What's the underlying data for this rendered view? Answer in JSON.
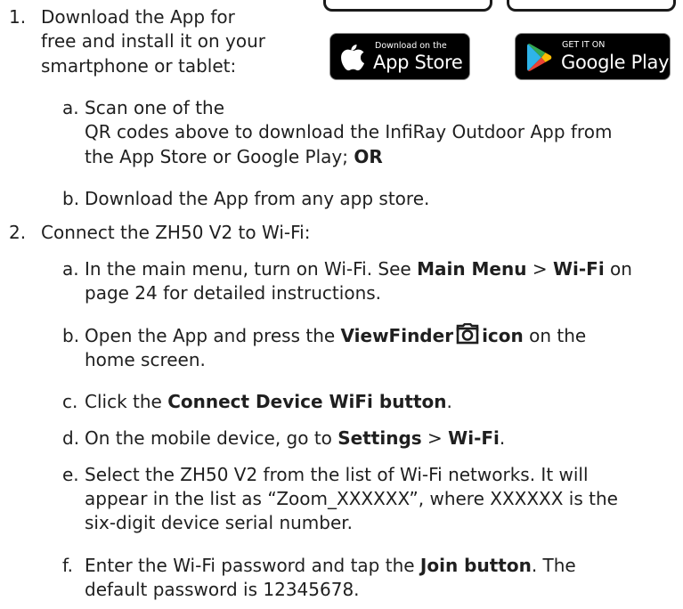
{
  "badges": {
    "app_store": {
      "small": "Download on the",
      "big": "App Store"
    },
    "google_play": {
      "small": "GET IT ON",
      "big": "Google Play"
    }
  },
  "step1": {
    "number": "1.",
    "lines": [
      "Download the App for",
      "free and install it on your",
      "smartphone or tablet:"
    ],
    "a": {
      "letter": "a.",
      "line1": "Scan one of the",
      "line2": "QR codes above to download the InfiRay Outdoor App from",
      "line3_pre": "the App Store or Google Play; ",
      "line3_bold": "OR"
    },
    "b": {
      "letter": "b.",
      "text": "Download the App from any app store."
    }
  },
  "step2": {
    "number": "2.",
    "text": "Connect the ZH50 V2 to Wi-Fi:",
    "a": {
      "letter": "a.",
      "pre": "In the main menu, turn on Wi-Fi. See ",
      "bold1": "Main Menu",
      "sep": " > ",
      "bold2": "Wi-Fi",
      "post": " on",
      "line2": "page 24 for detailed instructions."
    },
    "b": {
      "letter": "b.",
      "pre": "Open the App and press the ",
      "bold1": "ViewFinder",
      "bold2": "icon",
      "post": " on the",
      "line2": "home screen."
    },
    "c": {
      "letter": "c.",
      "pre": "Click the ",
      "bold": "Connect Device WiFi button",
      "post": "."
    },
    "d": {
      "letter": "d.",
      "pre": "On the mobile device, go to ",
      "bold1": "Settings",
      "sep": " > ",
      "bold2": "Wi-Fi",
      "post": "."
    },
    "e": {
      "letter": "e.",
      "line1": "Select the ZH50 V2 from the list of Wi-Fi networks. It will",
      "line2": "appear in the list as “Zoom_XXXXXX”, where XXXXXX is the",
      "line3": "six-digit device serial number."
    },
    "f": {
      "letter": "f.",
      "pre": "Enter the Wi-Fi password and tap the ",
      "bold": "Join button",
      "post": ". The",
      "line2": "default password is 12345678."
    }
  }
}
